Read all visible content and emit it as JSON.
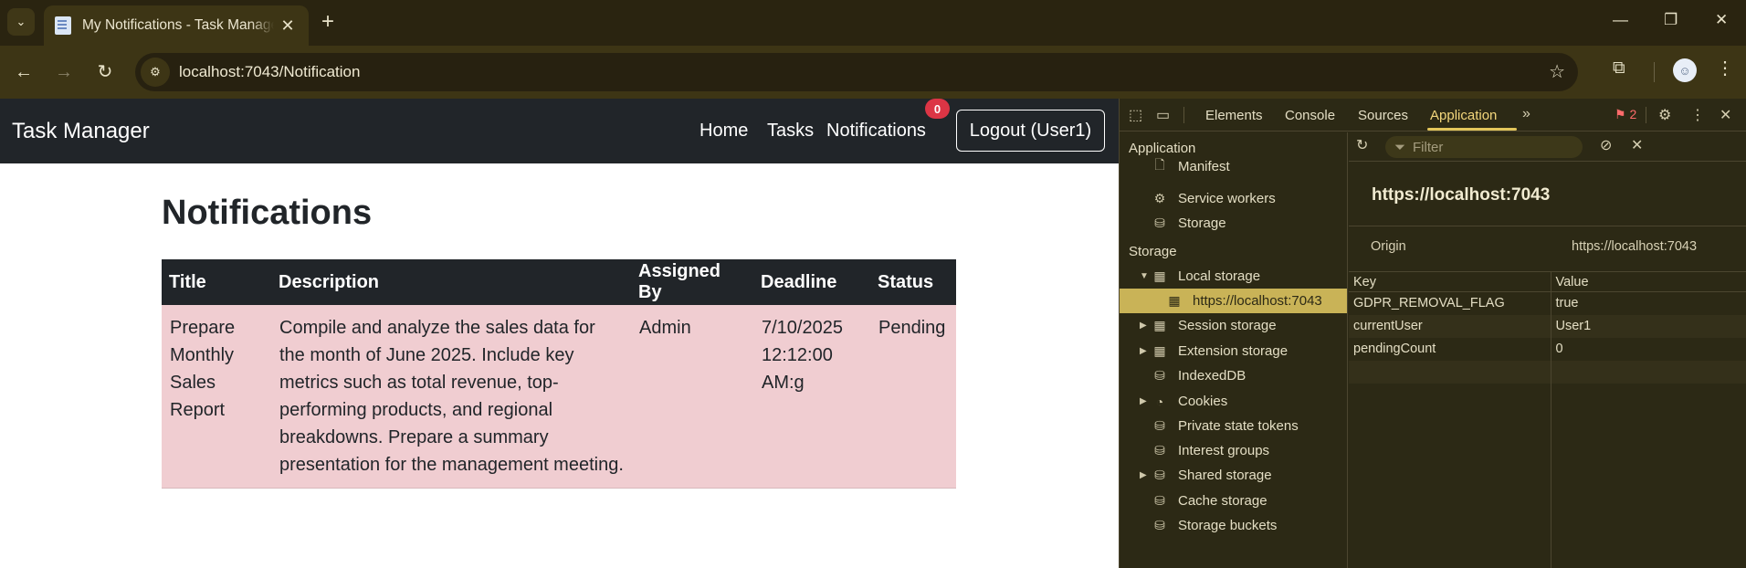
{
  "browser": {
    "tab": {
      "title": "My Notifications - Task Manager"
    },
    "address": "localhost:7043/Notification"
  },
  "app": {
    "brand": "Task Manager",
    "nav": {
      "home": "Home",
      "tasks": "Tasks",
      "notifications": "Notifications",
      "badge_count": "0",
      "logout": "Logout (User1)"
    },
    "page_title": "Notifications",
    "table": {
      "headers": {
        "title": "Title",
        "description": "Description",
        "assigned_by": "Assigned By",
        "deadline": "Deadline",
        "status": "Status"
      },
      "rows": [
        {
          "title": "Prepare Monthly Sales Report",
          "description": "Compile and analyze the sales data for the month of June 2025. Include key metrics such as total revenue, top-performing products, and regional breakdowns. Prepare a summary presentation for the management meeting.",
          "assigned_by": "Admin",
          "deadline": "7/10/2025 12:12:00 AM:g",
          "status": "Pending"
        }
      ]
    }
  },
  "devtools": {
    "tabs": {
      "elements": "Elements",
      "console": "Console",
      "sources": "Sources",
      "application": "Application"
    },
    "issues_count": "2",
    "sidebar": {
      "application_section": "Application",
      "application_items": {
        "manifest": "Manifest",
        "service_workers": "Service workers",
        "storage": "Storage"
      },
      "storage_section": "Storage",
      "storage_items": {
        "local_storage": "Local storage",
        "local_origin": "https://localhost:7043",
        "session_storage": "Session storage",
        "extension_storage": "Extension storage",
        "indexeddb": "IndexedDB",
        "cookies": "Cookies",
        "private_state_tokens": "Private state tokens",
        "interest_groups": "Interest groups",
        "shared_storage": "Shared storage",
        "cache_storage": "Cache storage",
        "storage_buckets": "Storage buckets"
      }
    },
    "main": {
      "filter_placeholder": "Filter",
      "origin_title": "https://localhost:7043",
      "origin_label": "Origin",
      "origin_value": "https://localhost:7043",
      "columns": {
        "key": "Key",
        "value": "Value"
      },
      "entries": [
        {
          "key": "GDPR_REMOVAL_FLAG",
          "value": "true"
        },
        {
          "key": "currentUser",
          "value": "User1"
        },
        {
          "key": "pendingCount",
          "value": "0"
        }
      ]
    }
  }
}
